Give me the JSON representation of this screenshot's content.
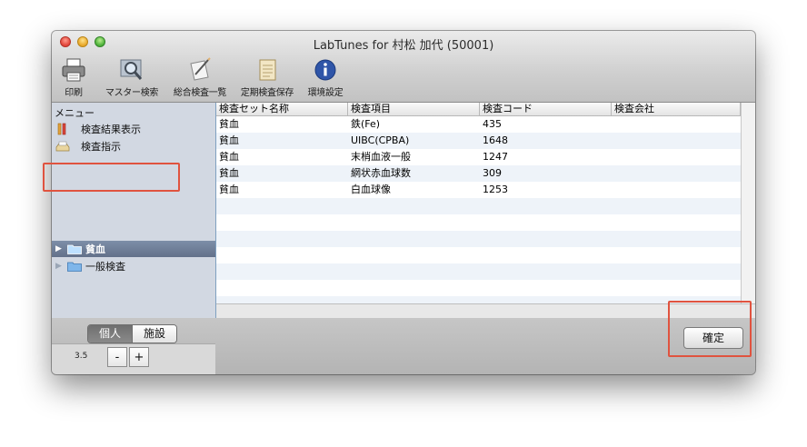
{
  "window": {
    "title": "LabTunes for 村松 加代 (50001)"
  },
  "toolbar": {
    "items": [
      {
        "label": "印刷",
        "icon": "printer-icon"
      },
      {
        "label": "マスター検索",
        "icon": "magnifier-icon"
      },
      {
        "label": "総合検査一覧",
        "icon": "pencil-note-icon"
      },
      {
        "label": "定期検査保存",
        "icon": "notepad-icon"
      },
      {
        "label": "環境設定",
        "icon": "info-icon"
      }
    ]
  },
  "sidebar": {
    "header": "メニュー",
    "items": [
      {
        "label": "検査結果表示",
        "icon": "test-tube-icon"
      },
      {
        "label": "検査指示",
        "icon": "tray-icon"
      }
    ],
    "tree": [
      {
        "label": "貧血",
        "selected": true
      },
      {
        "label": "一般検査",
        "selected": false
      }
    ]
  },
  "table": {
    "columns": [
      "検査セット名称",
      "検査項目",
      "検査コード",
      "検査会社"
    ],
    "rows": [
      [
        "貧血",
        "鉄(Fe)",
        "435",
        ""
      ],
      [
        "貧血",
        "UIBC(CPBA)",
        "1648",
        ""
      ],
      [
        "貧血",
        "末梢血液一般",
        "1247",
        ""
      ],
      [
        "貧血",
        "網状赤血球数",
        "309",
        ""
      ],
      [
        "貧血",
        "白血球像",
        "1253",
        ""
      ]
    ]
  },
  "footer": {
    "segment": {
      "left": "個人",
      "right": "施設",
      "selected": "left"
    },
    "version": "3.5",
    "minus": "-",
    "plus": "+",
    "confirm": "確定"
  },
  "colors": {
    "highlight": "#e0533f",
    "selection": "#6f7f98"
  }
}
